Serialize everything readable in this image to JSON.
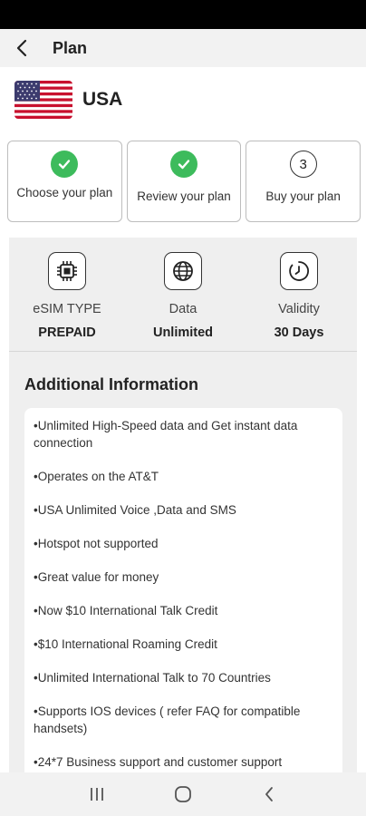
{
  "header": {
    "title": "Plan"
  },
  "country": {
    "name": "USA"
  },
  "steps": [
    {
      "label": "Choose your plan",
      "state": "done"
    },
    {
      "label": "Review your plan",
      "state": "done"
    },
    {
      "number": "3",
      "label": "Buy your plan",
      "state": "current"
    }
  ],
  "specs": [
    {
      "label": "eSIM TYPE",
      "value": "PREPAID",
      "icon": "chip-icon"
    },
    {
      "label": "Data",
      "value": "Unlimited",
      "icon": "globe-icon"
    },
    {
      "label": "Validity",
      "value": "30 Days",
      "icon": "clock-icon"
    }
  ],
  "additional_info": {
    "title": "Additional Information",
    "items": [
      "•Unlimited High-Speed data and Get instant data connection",
      "•Operates on the AT&T",
      "•USA Unlimited Voice ,Data and SMS",
      "•Hotspot not supported",
      "•Great value for money",
      "•Now $10 International Talk Credit",
      "•$10 International Roaming Credit",
      "•Unlimited International Talk to 70 Countries",
      "•Supports IOS devices ( refer FAQ for compatible handsets)",
      "•24*7 Business support and customer support"
    ]
  },
  "colors": {
    "check_green": "#3dbb5c",
    "panel_bg": "#efefef"
  }
}
